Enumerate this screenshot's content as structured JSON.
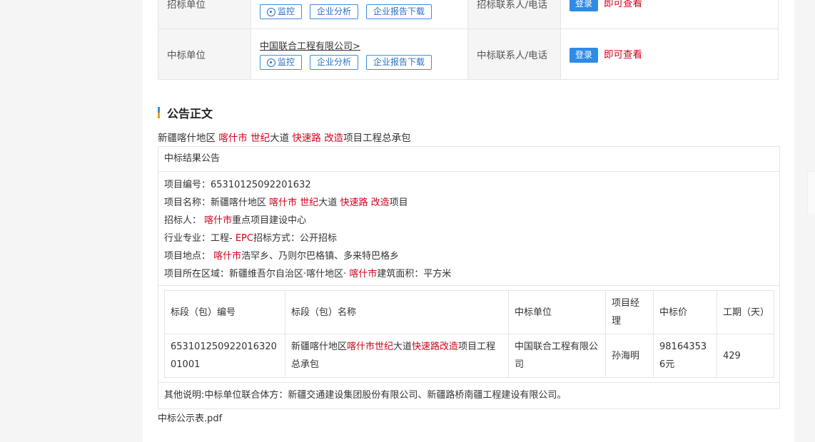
{
  "info": {
    "row1": {
      "label": "招标单位",
      "tags": [
        "监控",
        "企业分析",
        "企业报告下载"
      ],
      "contact_label": "招标联系人/电话",
      "login": "登录",
      "view": "即可查看"
    },
    "row2": {
      "label": "中标单位",
      "company": "中国联合工程有限公司>",
      "tags": [
        "监控",
        "企业分析",
        "企业报告下载"
      ],
      "contact_label": "中标联系人/电话",
      "login": "登录",
      "view": "即可查看"
    }
  },
  "section_title": "公告正文",
  "headline": {
    "p1": "新疆喀什地区 ",
    "h1": "喀什市",
    "p2": " ",
    "h2": "世纪",
    "p3": "大道 ",
    "h3": "快速路",
    "p4": " ",
    "h4": "改造",
    "p5": "项目工程总承包"
  },
  "doc": {
    "head": "中标结果公告",
    "line1": "项目编号：65310125092201632",
    "line2": {
      "p1": "项目名称：新疆喀什地区 ",
      "h1": "喀什市",
      "p2": " ",
      "h2": "世纪",
      "p3": "大道 ",
      "h3": "快速路",
      "p4": " ",
      "h4": "改造",
      "p5": "项目"
    },
    "line3": {
      "p1": "招标人： ",
      "h1": "喀什市",
      "p2": "重点项目建设中心"
    },
    "line4": {
      "p1": "行业专业：工程- ",
      "h1": "EPC",
      "p2": "招标方式：公开招标"
    },
    "line5": {
      "p1": "项目地点： ",
      "h1": "喀什市",
      "p2": "浩罕乡、乃则尔巴格镇、多来特巴格乡"
    },
    "line6": {
      "p1": "项目所在区域：新疆维吾尔自治区·喀什地区· ",
      "h1": "喀什市",
      "p2": "建筑面积：平方米"
    },
    "table": {
      "headers": [
        "标段（包）编号",
        "标段（包）名称",
        "中标单位",
        "项目经理",
        "中标价",
        "工期（天）"
      ],
      "row": {
        "code": "65310125092201632001001",
        "name": {
          "p1": "新疆喀什地区",
          "h1": "喀什市世纪",
          "p2": "大道",
          "h2": "快速路改造",
          "p3": "项目工程总承包"
        },
        "winner": "中国联合工程有限公司",
        "manager": "孙海明",
        "price": "981643536元",
        "days": "429"
      }
    },
    "foot": "其他说明:中标单位联合体方：新疆交通建设集团股份有限公司、新疆路桥南疆工程建设有限公司。"
  },
  "attachment": "中标公示表.pdf",
  "colors": {
    "highlight": "#d0021b",
    "accent": "#2f8be6"
  }
}
